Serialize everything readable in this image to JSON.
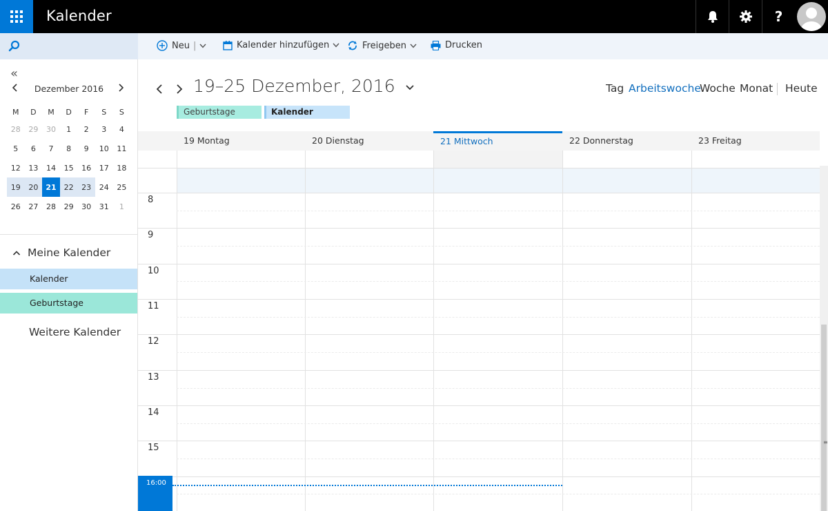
{
  "app": {
    "title": "Kalender"
  },
  "topbar": {
    "help_label": "?"
  },
  "search": {
    "icon": "search-icon"
  },
  "mini_calendar": {
    "collapse_label": "«",
    "month_label": "Dezember 2016",
    "weekday_headers": [
      "M",
      "D",
      "M",
      "D",
      "F",
      "S",
      "S"
    ],
    "weeks": [
      [
        "28",
        "29",
        "30",
        "1",
        "2",
        "3",
        "4"
      ],
      [
        "5",
        "6",
        "7",
        "8",
        "9",
        "10",
        "11"
      ],
      [
        "12",
        "13",
        "14",
        "15",
        "16",
        "17",
        "18"
      ],
      [
        "19",
        "20",
        "21",
        "22",
        "23",
        "24",
        "25"
      ],
      [
        "26",
        "27",
        "28",
        "29",
        "30",
        "31",
        "1"
      ]
    ],
    "today": "21"
  },
  "calendars": {
    "my_header": "Meine Kalender",
    "items": [
      {
        "label": "Kalender",
        "color": "#c5e2f8"
      },
      {
        "label": "Geburtstage",
        "color": "#9be7d9"
      }
    ],
    "more_label": "Weitere Kalender"
  },
  "commands": {
    "new_label": "Neu",
    "add_calendar_label": "Kalender hinzufügen",
    "share_label": "Freigeben",
    "print_label": "Drucken"
  },
  "main": {
    "range_title": "19–25 Dezember, 2016",
    "views": [
      "Tag",
      "Arbeitswoche",
      "Woche",
      "Monat"
    ],
    "active_view": "Arbeitswoche",
    "today_label": "Heute",
    "tags": [
      "Geburtstage",
      "Kalender"
    ],
    "days": [
      "19 Montag",
      "20 Dienstag",
      "21 Mittwoch",
      "22 Donnerstag",
      "23 Freitag"
    ],
    "today_day": "21 Mittwoch",
    "hours": [
      "8",
      "9",
      "10",
      "11",
      "12",
      "13",
      "14",
      "15"
    ],
    "current_time": "16:00"
  },
  "colors": {
    "accent": "#0078d7",
    "topbar": "#000000",
    "work_hours": "#eef5fb"
  }
}
